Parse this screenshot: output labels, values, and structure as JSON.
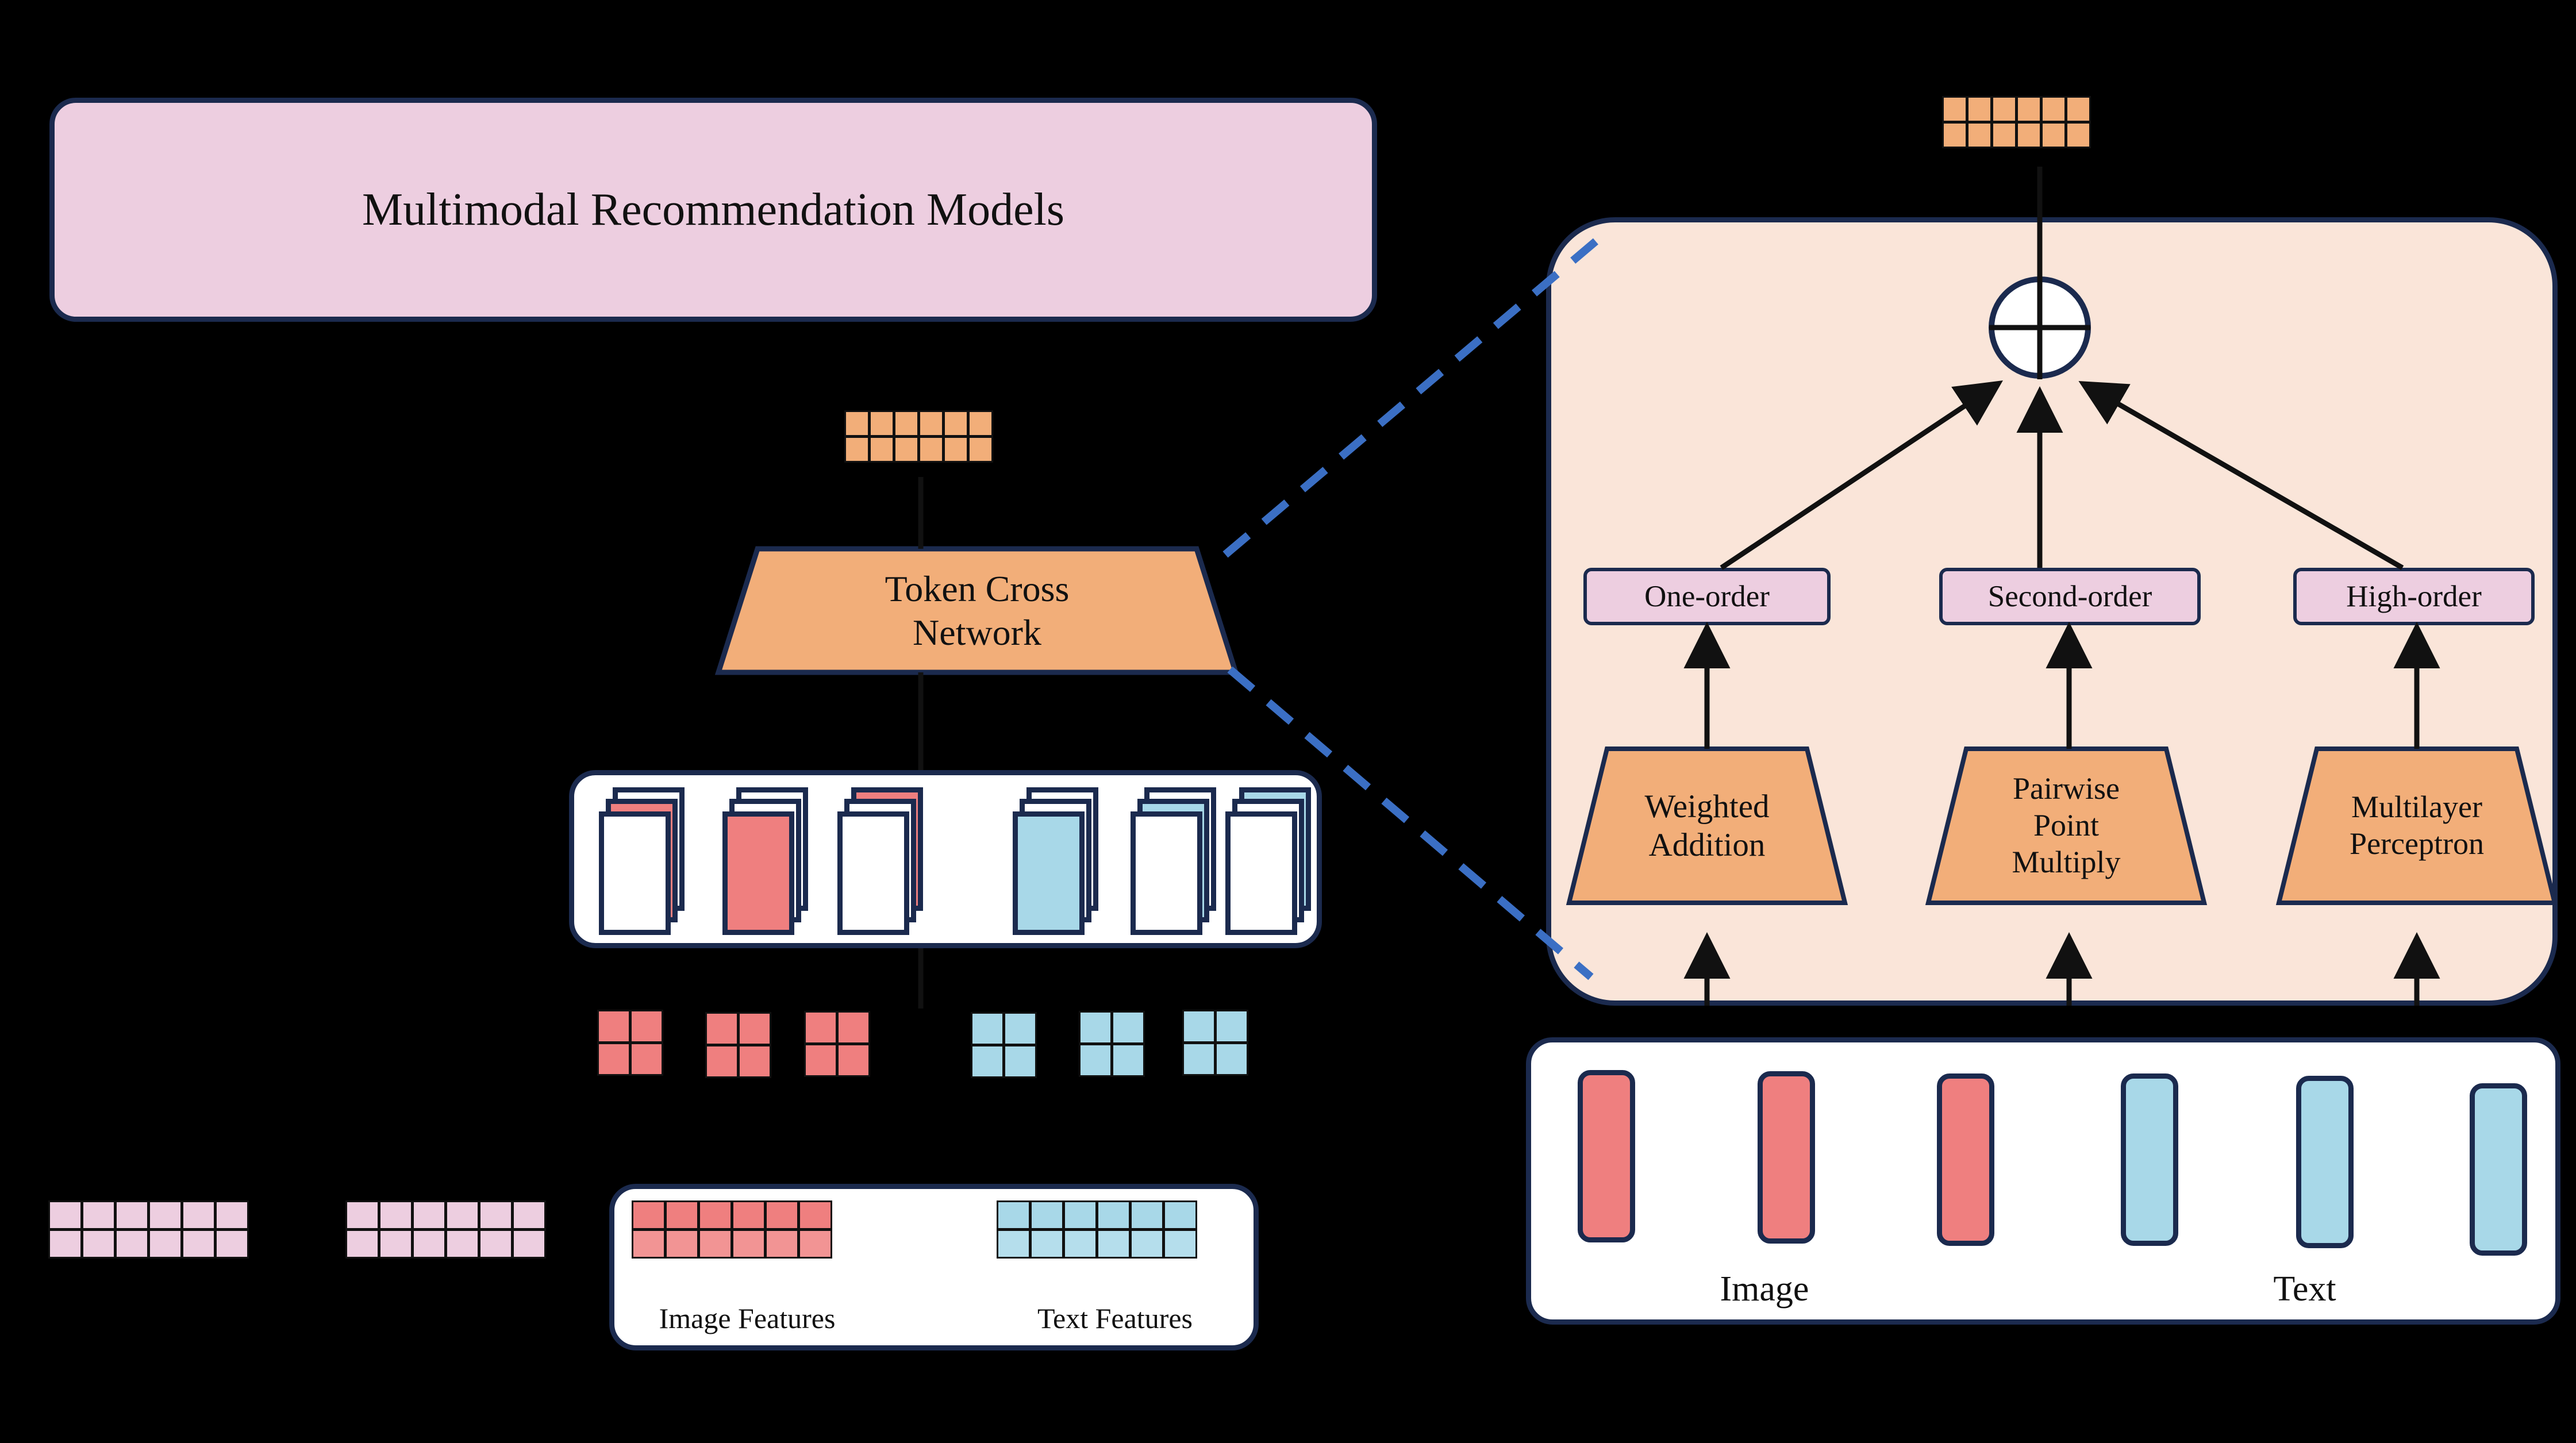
{
  "diagram": {
    "title_box": {
      "label": "Multimodal Recommendation Models"
    },
    "token_cross_network": {
      "label": "Token Cross\nNetwork"
    },
    "legend": {
      "image_features_label": "Image Features",
      "text_features_label": "Text Features"
    },
    "detail_panel": {
      "combine_node": {
        "symbol": "⊕",
        "name": "sum-node"
      },
      "order_pills": [
        {
          "label": "One-order"
        },
        {
          "label": "Second-order"
        },
        {
          "label": "High-order"
        }
      ],
      "operators": [
        {
          "label": "Weighted\nAddition"
        },
        {
          "label": "Pairwise\nPoint\nMultiply"
        },
        {
          "label": "Multilayer\nPerceptron"
        }
      ],
      "input_panel": {
        "image_label": "Image",
        "text_label": "Text",
        "image_token_count": 3,
        "text_token_count": 3
      }
    },
    "embedding_grids": {
      "output_token_grid_cols": 6,
      "output_token_grid_rows": 2,
      "pink_grid_cols": 6,
      "pink_grid_rows": 2,
      "small_token_cols": 2,
      "small_token_rows": 2,
      "legend_grid_cols": 6,
      "legend_grid_rows": 2
    },
    "colors": {
      "background": "#000000",
      "navy_border": "#1B2A4E",
      "pink": "#EDCEE0",
      "orange": "#F2AE79",
      "peach_panel": "#FAE5D9",
      "salmon": "#EF7F7F",
      "light_blue": "#A8D8E8",
      "dashed_blue": "#3B6FC4",
      "white": "#FFFFFF",
      "text": "#111111"
    }
  }
}
